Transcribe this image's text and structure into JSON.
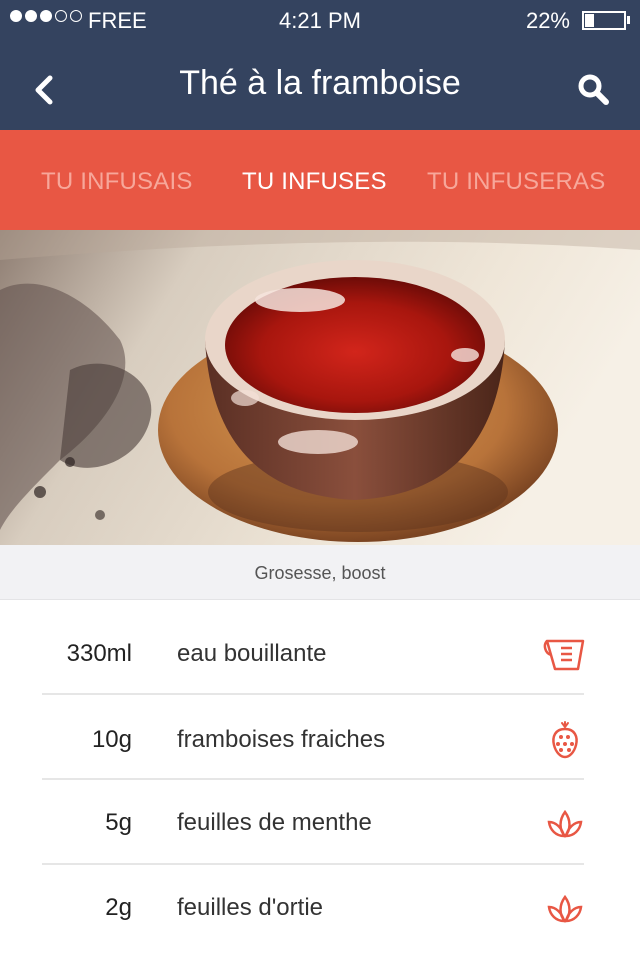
{
  "status_bar": {
    "carrier": "FREE",
    "time": "4:21  PM",
    "battery_pct": "22%",
    "battery_level": 0.22,
    "signal_bars": 5,
    "signal_filled": 3
  },
  "nav": {
    "title": "Thé à la framboise",
    "back_icon": "chevron-left-icon",
    "search_icon": "search-icon"
  },
  "tabs": [
    {
      "label": "TU INFUSAIS",
      "active": false
    },
    {
      "label": "TU INFUSES",
      "active": true
    },
    {
      "label": "TU INFUSERAS",
      "active": false
    }
  ],
  "hero": {
    "caption": "Grosesse, boost"
  },
  "ingredients": [
    {
      "qty": "330ml",
      "name": "eau bouillante",
      "icon": "measuring-cup-icon"
    },
    {
      "qty": "10g",
      "name": "framboises fraiches",
      "icon": "raspberry-icon"
    },
    {
      "qty": "5g",
      "name": "feuilles de menthe",
      "icon": "leaf-icon"
    },
    {
      "qty": "2g",
      "name": "feuilles d'ortie",
      "icon": "leaf-icon"
    }
  ],
  "colors": {
    "nav_bg": "#34435f",
    "tab_bg": "#e85744",
    "tab_inactive": "#f7a79a",
    "accent": "#e85744"
  }
}
